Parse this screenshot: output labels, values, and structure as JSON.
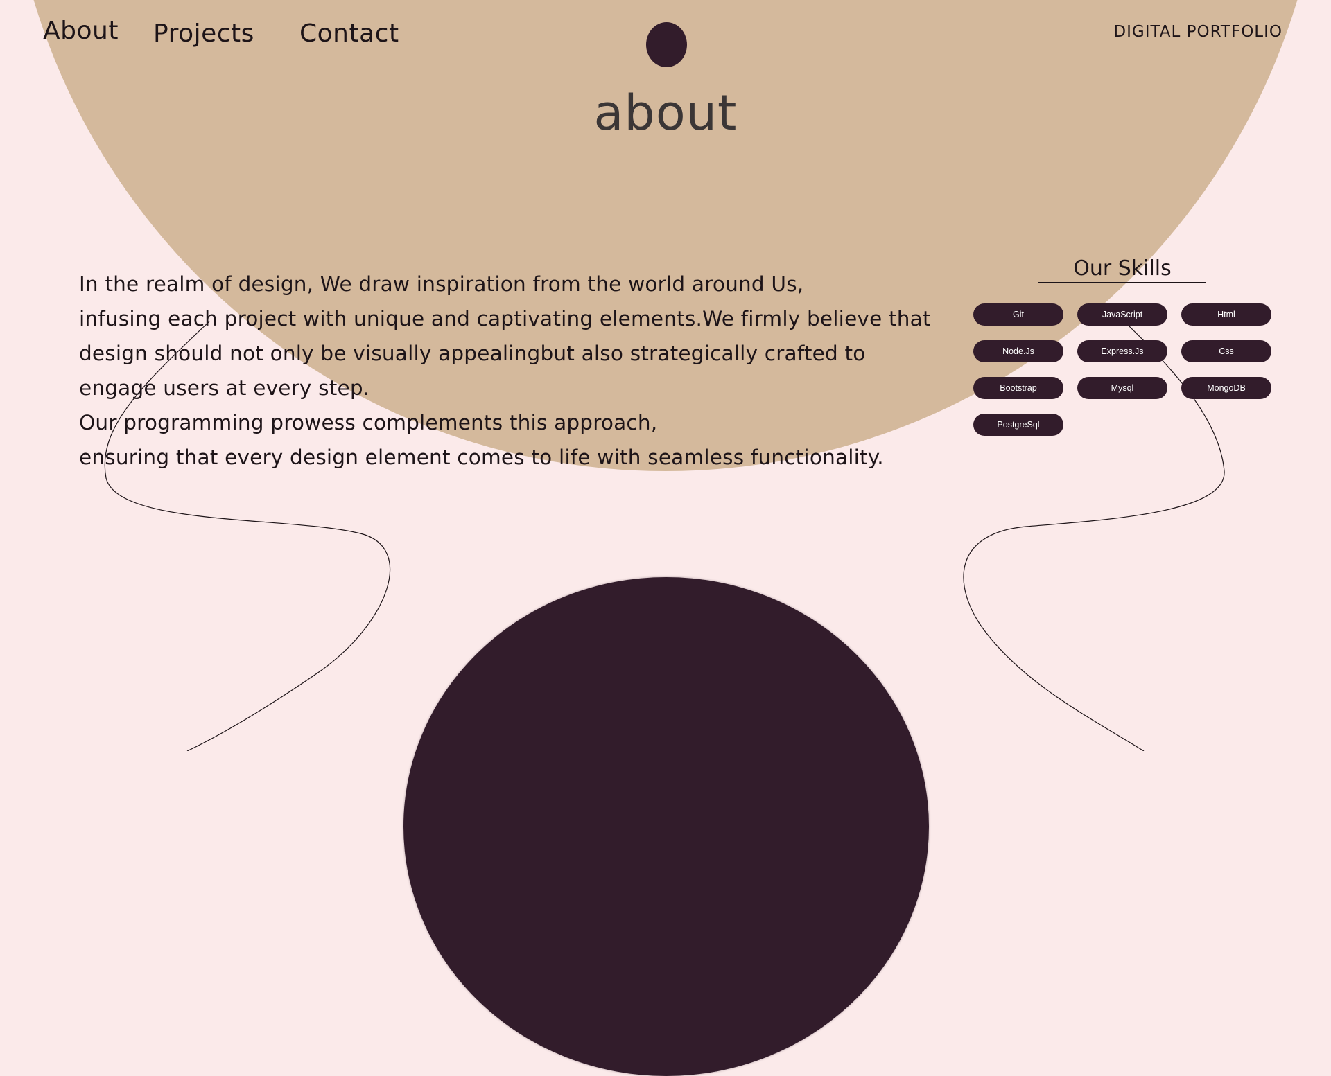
{
  "nav": {
    "about": "About",
    "projects": "Projects",
    "contact": "Contact"
  },
  "brand": "DIGITAL PORTFOLIO",
  "page_title": "about",
  "about": {
    "lines": [
      "In the realm of design, We draw inspiration from the world around Us,",
      "infusing each project with unique and captivating elements.We firmly believe that",
      "design should not only be visually appealingbut also strategically crafted to",
      "engage users at every step.",
      "Our programming prowess complements this approach,",
      "ensuring that every design element comes to life with seamless functionality."
    ]
  },
  "skills": {
    "title": "Our Skills",
    "items": [
      "Git",
      "JavaScript",
      "Html",
      "Node.Js",
      "Express.Js",
      "Css",
      "Bootstrap",
      "Mysql",
      "MongoDB",
      "PostgreSql"
    ]
  },
  "colors": {
    "background": "#fbeaea",
    "tan": "#d4b99c",
    "plum": "#321c2b"
  }
}
